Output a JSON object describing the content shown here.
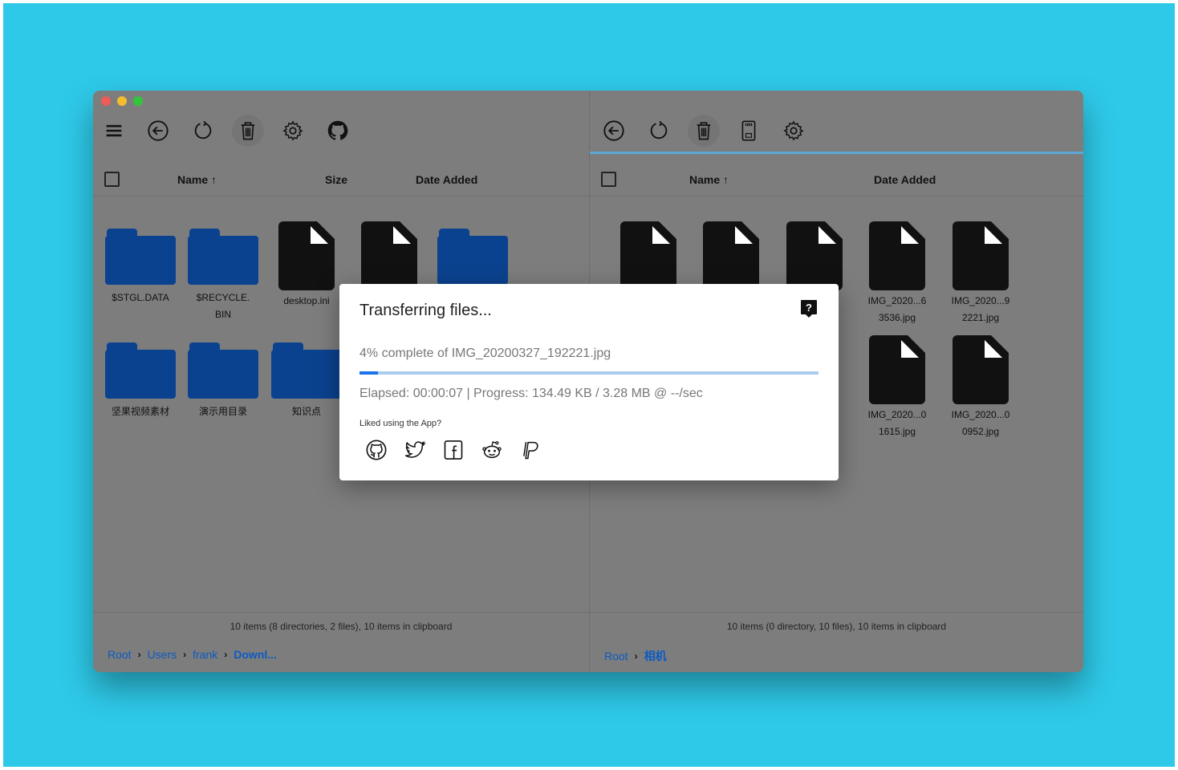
{
  "window": {
    "traffic_colors": [
      "#ef5b56",
      "#f4bd2f",
      "#31c53d"
    ]
  },
  "left_pane": {
    "toolbar": [
      "menu-icon",
      "back-icon",
      "refresh-icon",
      "trash-icon",
      "gear-icon",
      "github-icon"
    ],
    "columns": {
      "name": "Name",
      "sort_arrow": "↑",
      "size": "Size",
      "date": "Date Added"
    },
    "items": [
      {
        "label": "$STGL.DATA",
        "type": "folder"
      },
      {
        "label": "$RECYCLE.BIN",
        "type": "folder"
      },
      {
        "label": "desktop.ini",
        "type": "file"
      },
      {
        "label": "",
        "type": "file"
      },
      {
        "label": "",
        "type": "folder"
      },
      {
        "label": "坚果视频素材",
        "type": "folder"
      },
      {
        "label": "演示用目录",
        "type": "folder"
      },
      {
        "label": "知识点",
        "type": "folder"
      }
    ],
    "status": "10 items (8 directories, 2 files), 10 items in clipboard",
    "breadcrumb": {
      "root": "Root",
      "users": "Users",
      "frank": "frank",
      "current": "Downl..."
    }
  },
  "right_pane": {
    "toolbar": [
      "back-icon",
      "refresh-icon",
      "trash-icon",
      "sd-card-icon",
      "gear-icon"
    ],
    "columns": {
      "name": "Name",
      "sort_arrow": "↑",
      "date": "Date Added"
    },
    "items": [
      {
        "label": "",
        "type": "file"
      },
      {
        "label": "",
        "type": "file"
      },
      {
        "label": "",
        "type": "file"
      },
      {
        "label": "IMG_2020...6 3536.jpg",
        "type": "file"
      },
      {
        "label": "IMG_2020...9 2221.jpg",
        "type": "file"
      },
      {
        "label": "IMG_2020...0 1615.jpg",
        "type": "file"
      },
      {
        "label": "IMG_2020...0 0952.jpg",
        "type": "file"
      }
    ],
    "status": "10 items (0 directory, 10 files), 10 items in clipboard",
    "breadcrumb": {
      "root": "Root",
      "current": "相机"
    }
  },
  "dialog": {
    "title": "Transferring files...",
    "line1": "4% complete of IMG_20200327_192221.jpg",
    "progress_percent": 4,
    "line2": "Elapsed: 00:00:07 | Progress: 134.49 KB / 3.28 MB @ --/sec",
    "liked": "Liked using the App?",
    "social": [
      "github-icon",
      "twitter-icon",
      "facebook-icon",
      "reddit-icon",
      "paypal-icon"
    ]
  },
  "colors": {
    "background": "#2ec9e8",
    "folder": "#0b428f",
    "link": "#0b5bc4",
    "progress": "#1a73e8"
  }
}
